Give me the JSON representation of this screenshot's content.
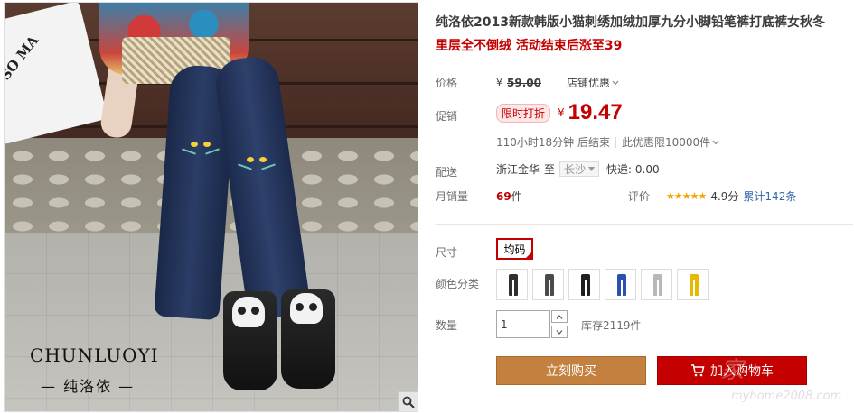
{
  "photo": {
    "bag_text": "SO MA",
    "brand_en": "CHUNLUOYI",
    "brand_cn": "— 纯洛依 —"
  },
  "product": {
    "title": "纯洛依2013新款韩版小猫刺绣加绒加厚九分小脚铅笔裤打底裤女秋冬",
    "subtitle": "里层全不倒绒 活动结束后涨至39"
  },
  "price": {
    "label": "价格",
    "currency": "¥",
    "original": "59.00",
    "shop_promo": "店铺优惠"
  },
  "promo": {
    "label": "促销",
    "tag": "限时打折",
    "currency": "¥",
    "price": "19.47",
    "countdown": "110小时18分钟 后结束",
    "limit": "此优惠限10000件"
  },
  "shipping": {
    "label": "配送",
    "from": "浙江金华",
    "to_word": "至",
    "to_city": "长沙",
    "fee": "快递: 0.00"
  },
  "sales": {
    "label": "月销量",
    "count": "69",
    "unit": "件",
    "rating_label": "评价",
    "stars": "★★★★★",
    "score": "4.9分",
    "review_total": "累计142条"
  },
  "options": {
    "size_label": "尺寸",
    "size_value": "均码",
    "color_label": "颜色分类",
    "colors": [
      "#2f2f2f",
      "#4a4a4a",
      "#1f1f1f",
      "#2a4fb5",
      "#b8b8b8",
      "#e6b800"
    ]
  },
  "quantity": {
    "label": "数量",
    "value": "1",
    "stock": "库存2119件"
  },
  "actions": {
    "buy": "立刻购买",
    "cart": "加入购物车"
  },
  "watermark": {
    "main": "家",
    "url": "myhome2008.com"
  },
  "colors": {
    "accent_red": "#c40000",
    "buy_orange": "#c4803f",
    "star_orange": "#f2a500"
  }
}
